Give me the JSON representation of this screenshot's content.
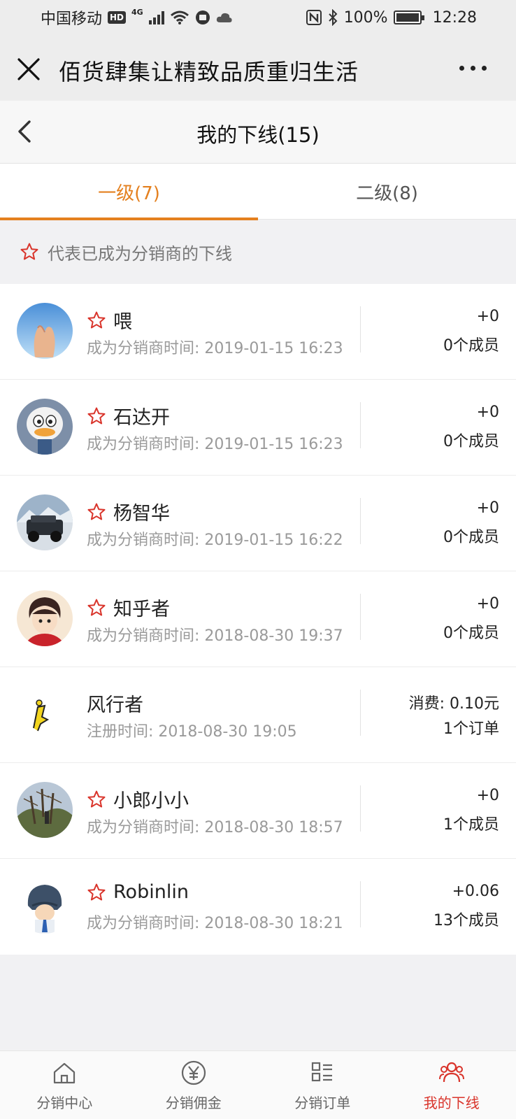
{
  "status_bar": {
    "carrier": "中国移动",
    "hd": "HD",
    "network": "4G",
    "battery": "100%",
    "time": "12:28"
  },
  "title_bar": {
    "title": "佰货肆集让精致品质重归生活"
  },
  "sub_header": {
    "title": "我的下线(15)"
  },
  "tabs": [
    {
      "label": "一级(7)",
      "active": true
    },
    {
      "label": "二级(8)",
      "active": false
    }
  ],
  "notice": {
    "text": "代表已成为分销商的下线"
  },
  "members": [
    {
      "name": "喂",
      "starred": true,
      "time": "成为分销商时间: 2019-01-15 16:23",
      "right_top": "+0",
      "right_bottom": "0个成员",
      "avatar": "hands"
    },
    {
      "name": "石达开",
      "starred": true,
      "time": "成为分销商时间: 2019-01-15 16:23",
      "right_top": "+0",
      "right_bottom": "0个成员",
      "avatar": "duck"
    },
    {
      "name": "杨智华",
      "starred": true,
      "time": "成为分销商时间: 2019-01-15 16:22",
      "right_top": "+0",
      "right_bottom": "0个成员",
      "avatar": "jeep"
    },
    {
      "name": "知乎者",
      "starred": true,
      "time": "成为分销商时间: 2018-08-30 19:37",
      "right_top": "+0",
      "right_bottom": "0个成员",
      "avatar": "anime-boy"
    },
    {
      "name": "风行者",
      "starred": false,
      "time": "注册时间: 2018-08-30 19:05",
      "right_top": "消费: 0.10元",
      "right_bottom": "1个订单",
      "avatar": "bingo-doodle"
    },
    {
      "name": "小郎小小",
      "starred": true,
      "time": "成为分销商时间: 2018-08-30 18:57",
      "right_top": "+0",
      "right_bottom": "1个成员",
      "avatar": "orchard"
    },
    {
      "name": "Robinlin",
      "starred": true,
      "time": "成为分销商时间: 2018-08-30 18:21",
      "right_top": "+0.06",
      "right_bottom": "13个成员",
      "avatar": "helmet-cartoon"
    }
  ],
  "bottom_nav": [
    {
      "label": "分销中心",
      "icon": "home-icon",
      "active": false
    },
    {
      "label": "分销佣金",
      "icon": "yen-icon",
      "active": false
    },
    {
      "label": "分销订单",
      "icon": "orders-icon",
      "active": false
    },
    {
      "label": "我的下线",
      "icon": "team-icon",
      "active": true
    }
  ],
  "colors": {
    "accent": "#e4801f",
    "active_nav": "#d9342b",
    "star": "#d9342b"
  }
}
